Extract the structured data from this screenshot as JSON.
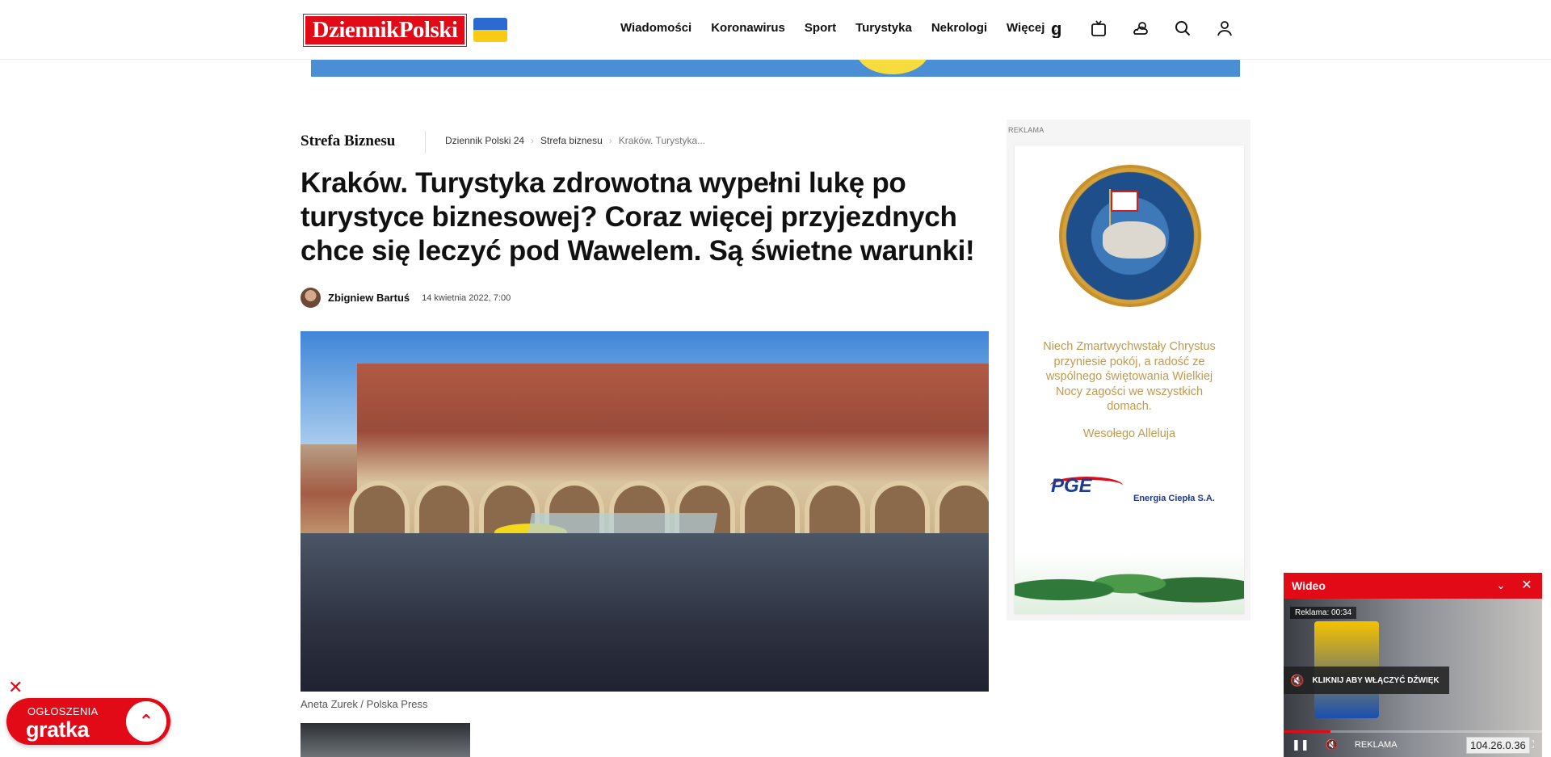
{
  "header": {
    "logo_text": "DziennikPolski",
    "nav": [
      "Wiadomości",
      "Koronawirus",
      "Sport",
      "Turystyka",
      "Nekrologi",
      "Więcej"
    ],
    "icons": [
      "gratka-g-icon",
      "tv-icon",
      "weather-icon",
      "search-icon",
      "user-icon"
    ]
  },
  "breadcrumb": {
    "section": "Strefa Biznesu",
    "items": [
      "Dziennik Polski 24",
      "Strefa biznesu",
      "Kraków. Turystyka..."
    ]
  },
  "article": {
    "title": "Kraków. Turystyka zdrowotna wypełni lukę po turystyce biznesowej? Coraz więcej przyjezdnych chce się leczyć pod Wawelem. Są świetne warunki!",
    "author": "Zbigniew Bartuś",
    "date": "14 kwietnia 2022, 7:00",
    "image_caption": "Aneta Zurek / Polska Press"
  },
  "ad": {
    "label": "REKLAMA",
    "text": "Niech Zmartwychwstały Chrystus przyniesie pokój, a radość ze wspólnego świętowania Wielkiej Nocy zagości we wszystkich domach.",
    "greeting": "Wesołego Alleluja",
    "brand": "PGE",
    "brand_sub": "Energia Ciepła S.A."
  },
  "video": {
    "title": "Wideo",
    "ad_timer": "Reklama: 00:34",
    "unmute_label": "KLIKNIJ ABY WŁĄCZYĆ DŹWIĘK",
    "controls_label": "REKLAMA",
    "ip": "104.26.0.36",
    "progress": 0.18
  },
  "gratka": {
    "sub": "OGŁOSZENIA",
    "name": "gratka"
  },
  "colors": {
    "brand_red": "#e20a17",
    "ad_gold": "#c09a4a",
    "pge_blue": "#1d3b8f"
  }
}
